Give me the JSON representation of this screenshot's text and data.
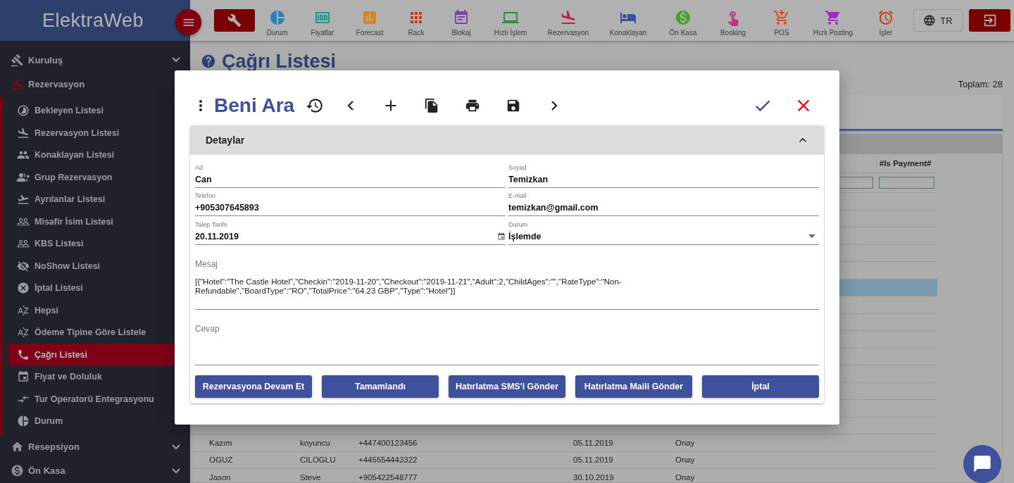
{
  "app": {
    "logo": "ElektraWeb",
    "language": "TR"
  },
  "toolbar": [
    {
      "label": "Durum",
      "color": "#2f7fb8"
    },
    {
      "label": "Fiyatlar",
      "color": "#1a9a8c"
    },
    {
      "label": "Forecast",
      "color": "#d6861e"
    },
    {
      "label": "Rack",
      "color": "#c83a1e"
    },
    {
      "label": "Blokaj",
      "color": "#7547a8"
    },
    {
      "label": "Hızlı İşlem",
      "color": "#23933a"
    },
    {
      "label": "Rezervasyon",
      "color": "#c0203e"
    },
    {
      "label": "Konaklayan",
      "color": "#3b50a0"
    },
    {
      "label": "Ön Kasa",
      "color": "#4e9e2a"
    },
    {
      "label": "Booking",
      "color": "#cc2e7e"
    },
    {
      "label": "POS",
      "color": "#dd4a1c"
    },
    {
      "label": "Hızlı Posting",
      "color": "#a02cc0"
    },
    {
      "label": "İşler",
      "color": "#cc3a10"
    }
  ],
  "sidebar": {
    "sections": [
      {
        "label": "Kuruluş",
        "expanded": false
      },
      {
        "label": "Rezervasyon",
        "expanded": true,
        "children": [
          {
            "label": "Bekleyen Listesi",
            "selected": false
          },
          {
            "label": "Rezervasyon Listesi",
            "selected": false
          },
          {
            "label": "Konaklayan Listesi",
            "selected": false
          },
          {
            "label": "Grup Rezervasyon",
            "selected": false
          },
          {
            "label": "Ayrılanlar Listesi",
            "selected": false
          },
          {
            "label": "Misafir İsim Listesi",
            "selected": false
          },
          {
            "label": "KBS Listesi",
            "selected": false
          },
          {
            "label": "NoShow Listesi",
            "selected": false
          },
          {
            "label": "İptal Listesi",
            "selected": false
          },
          {
            "label": "Hepsi",
            "selected": false
          },
          {
            "label": "Ödeme Tipine Göre Listele",
            "selected": false
          },
          {
            "label": "Çağrı Listesi",
            "selected": true
          },
          {
            "label": "Fiyat ve Doluluk",
            "selected": false
          },
          {
            "label": "Tur Operatorü Entegrasyonu",
            "selected": false
          },
          {
            "label": "Durum",
            "selected": false
          }
        ]
      },
      {
        "label": "Resepsiyon",
        "expanded": false
      },
      {
        "label": "Ön Kasa",
        "expanded": false
      }
    ]
  },
  "page": {
    "title": "Çağrı Listesi",
    "total": "Toplam: 28",
    "table": {
      "columns": [
        {
          "label": "#Is Payment#"
        }
      ],
      "rows": [
        {
          "selected": false
        },
        {
          "selected": false
        },
        {
          "selected": false
        },
        {
          "selected": false
        },
        {
          "selected": false
        },
        {
          "selected": true
        },
        {
          "selected": false
        },
        {
          "selected": false
        },
        {
          "selected": false
        },
        {
          "selected": false
        },
        {
          "selected": false
        },
        {
          "selected": false
        },
        {
          "selected": false
        },
        {
          "selected": false
        },
        {
          "selected": false,
          "cells": [
            "Kazım",
            "koyuncu",
            "+447400123456",
            "05.11.2019",
            "Onay"
          ]
        },
        {
          "selected": false,
          "cells": [
            "OGUZ",
            "CILOGLU",
            "+445554443322",
            "05.11.2019",
            "Onay"
          ]
        },
        {
          "selected": false,
          "cells": [
            "Jason",
            "Steve",
            "+905422548777",
            "30.10.2019",
            "Onay"
          ]
        }
      ]
    }
  },
  "dialog": {
    "title": "Beni Ara",
    "section": {
      "title": "Detaylar",
      "expanded": true,
      "fields": [
        {
          "label": "Ad",
          "value": "Can",
          "kind": "text"
        },
        {
          "label": "Soyad",
          "value": "Temizkan",
          "kind": "text"
        },
        {
          "label": "Telefon",
          "value": "+905307645893",
          "kind": "text"
        },
        {
          "label": "E-mail",
          "value": "temizkan@gmail.com",
          "kind": "text"
        },
        {
          "label": "Talep Tarihi",
          "value": "20.11.2019",
          "kind": "date"
        },
        {
          "label": "Durum",
          "value": "İşlemde",
          "kind": "select"
        }
      ],
      "message": {
        "label": "Mesaj",
        "value": "[{\"Hotel\":\"The Castle Hotel\",\"Checkin\":\"2019-11-20\",\"Checkout\":\"2019-11-21\",\"Adult\":2,\"ChildAges\":\"\",\"RateType\":\"Non-Refundable\",\"BoardType\":\"RO\",\"TotalPrice\":\"64.23 GBP\",\"Type\":\"Hotel\"}]"
      },
      "reply": {
        "label": "Cevap"
      },
      "buttons": [
        "Rezervasyona Devam Et",
        "Tamamlandı",
        "Hatırlatma SMS'i Gönder",
        "Hatırlatma Maili Gönder",
        "İptal"
      ]
    }
  }
}
